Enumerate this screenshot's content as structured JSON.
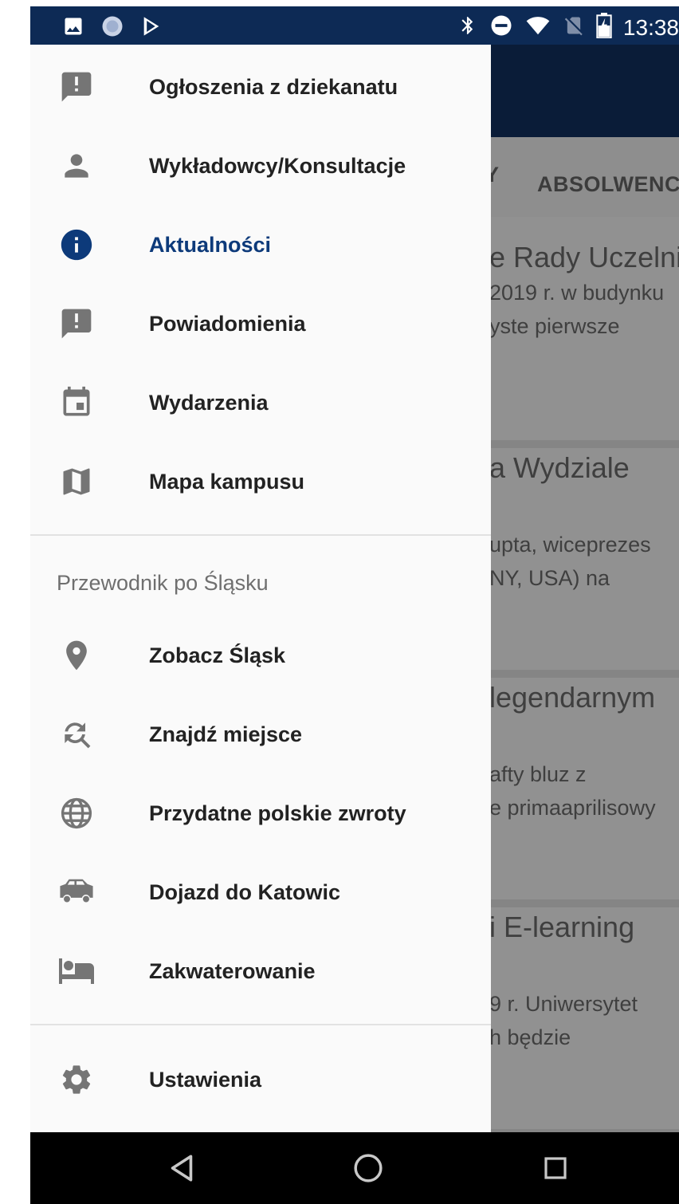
{
  "status_bar": {
    "time": "13:38",
    "left_icons": [
      "image-icon",
      "app-circle-icon",
      "play-store-icon"
    ],
    "right_icons": [
      "bluetooth-icon",
      "do-not-disturb-icon",
      "wifi-icon",
      "no-sim-icon",
      "battery-charging-icon"
    ]
  },
  "background_app": {
    "tabs": [
      "Y",
      "ABSOLWENCI"
    ],
    "cards": [
      {
        "title": "e Rady Uczelni",
        "lines": [
          "2019 r. w budynku",
          "yste pierwsze"
        ]
      },
      {
        "title": "a Wydziale",
        "lines": [
          "upta, wiceprezes",
          "NY, USA) na"
        ]
      },
      {
        "title": "legendarnym",
        "lines": [
          "afty bluz z",
          "e primaaprilisowy"
        ]
      },
      {
        "title": "i E-learning",
        "lines": [
          "9 r. Uniwersytet",
          "h będzie"
        ]
      }
    ]
  },
  "drawer": {
    "main_items": [
      {
        "label": "Ogłoszenia z dziekanatu",
        "icon": "announcement-icon",
        "active": false
      },
      {
        "label": "Wykładowcy/Konsultacje",
        "icon": "person-icon",
        "active": false
      },
      {
        "label": "Aktualności",
        "icon": "info-icon",
        "active": true
      },
      {
        "label": "Powiadomienia",
        "icon": "announcement-icon",
        "active": false
      },
      {
        "label": "Wydarzenia",
        "icon": "calendar-icon",
        "active": false
      },
      {
        "label": "Mapa kampusu",
        "icon": "map-icon",
        "active": false
      }
    ],
    "section_title": "Przewodnik po Śląsku",
    "guide_items": [
      {
        "label": "Zobacz Śląsk",
        "icon": "location-pin-icon"
      },
      {
        "label": "Znajdź miejsce",
        "icon": "find-replace-icon"
      },
      {
        "label": "Przydatne polskie zwroty",
        "icon": "globe-icon"
      },
      {
        "label": "Dojazd do Katowic",
        "icon": "car-icon"
      },
      {
        "label": "Zakwaterowanie",
        "icon": "bed-icon"
      }
    ],
    "settings_item": {
      "label": "Ustawienia",
      "icon": "gear-icon"
    }
  },
  "navigation_bar": [
    "back-icon",
    "home-icon",
    "recents-icon"
  ],
  "colors": {
    "status_bar": "#0d2a55",
    "app_bar": "#0a1c38",
    "active_item": "#0d3a7a",
    "icon_gray": "#757575",
    "drawer_bg": "#fafafa"
  }
}
